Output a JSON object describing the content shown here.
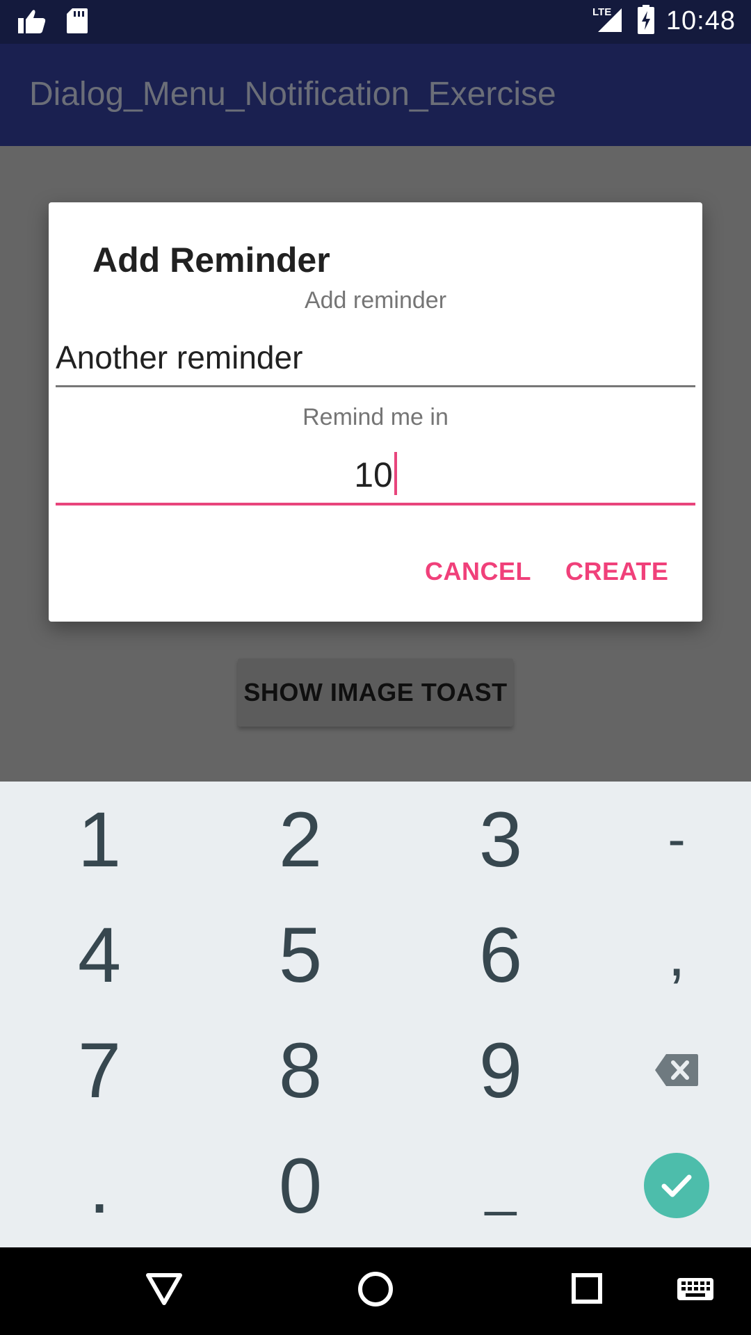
{
  "status_bar": {
    "time": "10:48",
    "network": "LTE",
    "icons": [
      "thumbs-up-icon",
      "sd-card-icon",
      "lte-signal-icon",
      "battery-charging-icon"
    ]
  },
  "app_bar": {
    "title": "Dialog_Menu_Notification_Exercise"
  },
  "content": {
    "show_image_toast_label": "SHOW IMAGE TOAST"
  },
  "dialog": {
    "title": "Add Reminder",
    "reminder_hint": "Add reminder",
    "reminder_value": "Another reminder",
    "remind_hint": "Remind me in",
    "remind_value": "10",
    "cancel_label": "CANCEL",
    "create_label": "CREATE"
  },
  "keyboard": {
    "row1": [
      "1",
      "2",
      "3",
      "-"
    ],
    "row2": [
      "4",
      "5",
      "6",
      ","
    ],
    "row3": [
      "7",
      "8",
      "9"
    ],
    "row4": [
      ".",
      "0",
      "_"
    ],
    "backspace_icon": "backspace-icon",
    "done_icon": "check-icon"
  },
  "nav_bar": {
    "icons": [
      "back-icon",
      "home-icon",
      "recents-icon",
      "keyboard-icon"
    ]
  },
  "colors": {
    "accent": "#f0407a",
    "app_bar": "#1a2050",
    "status_bar": "#141a3d",
    "done_button": "#4dbdab",
    "key_text": "#37474f"
  }
}
